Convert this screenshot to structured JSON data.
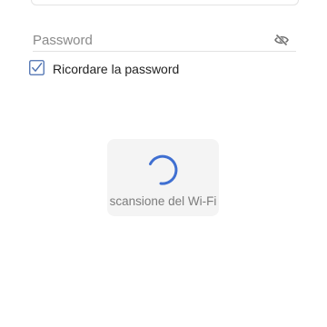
{
  "form": {
    "password_placeholder": "Password",
    "password_value": "",
    "visibility_icon": "eye-off-icon",
    "remember_label": "Ricordare la password",
    "remember_checked": true
  },
  "scan": {
    "label": "scansione del Wi-Fi",
    "spinner_icon": "loading-spinner-icon"
  },
  "colors": {
    "accent": "#3f6fd1",
    "checkbox": "#4a6fb0",
    "card_background": "#f4f4f4",
    "muted_text": "#7c7c7c"
  }
}
